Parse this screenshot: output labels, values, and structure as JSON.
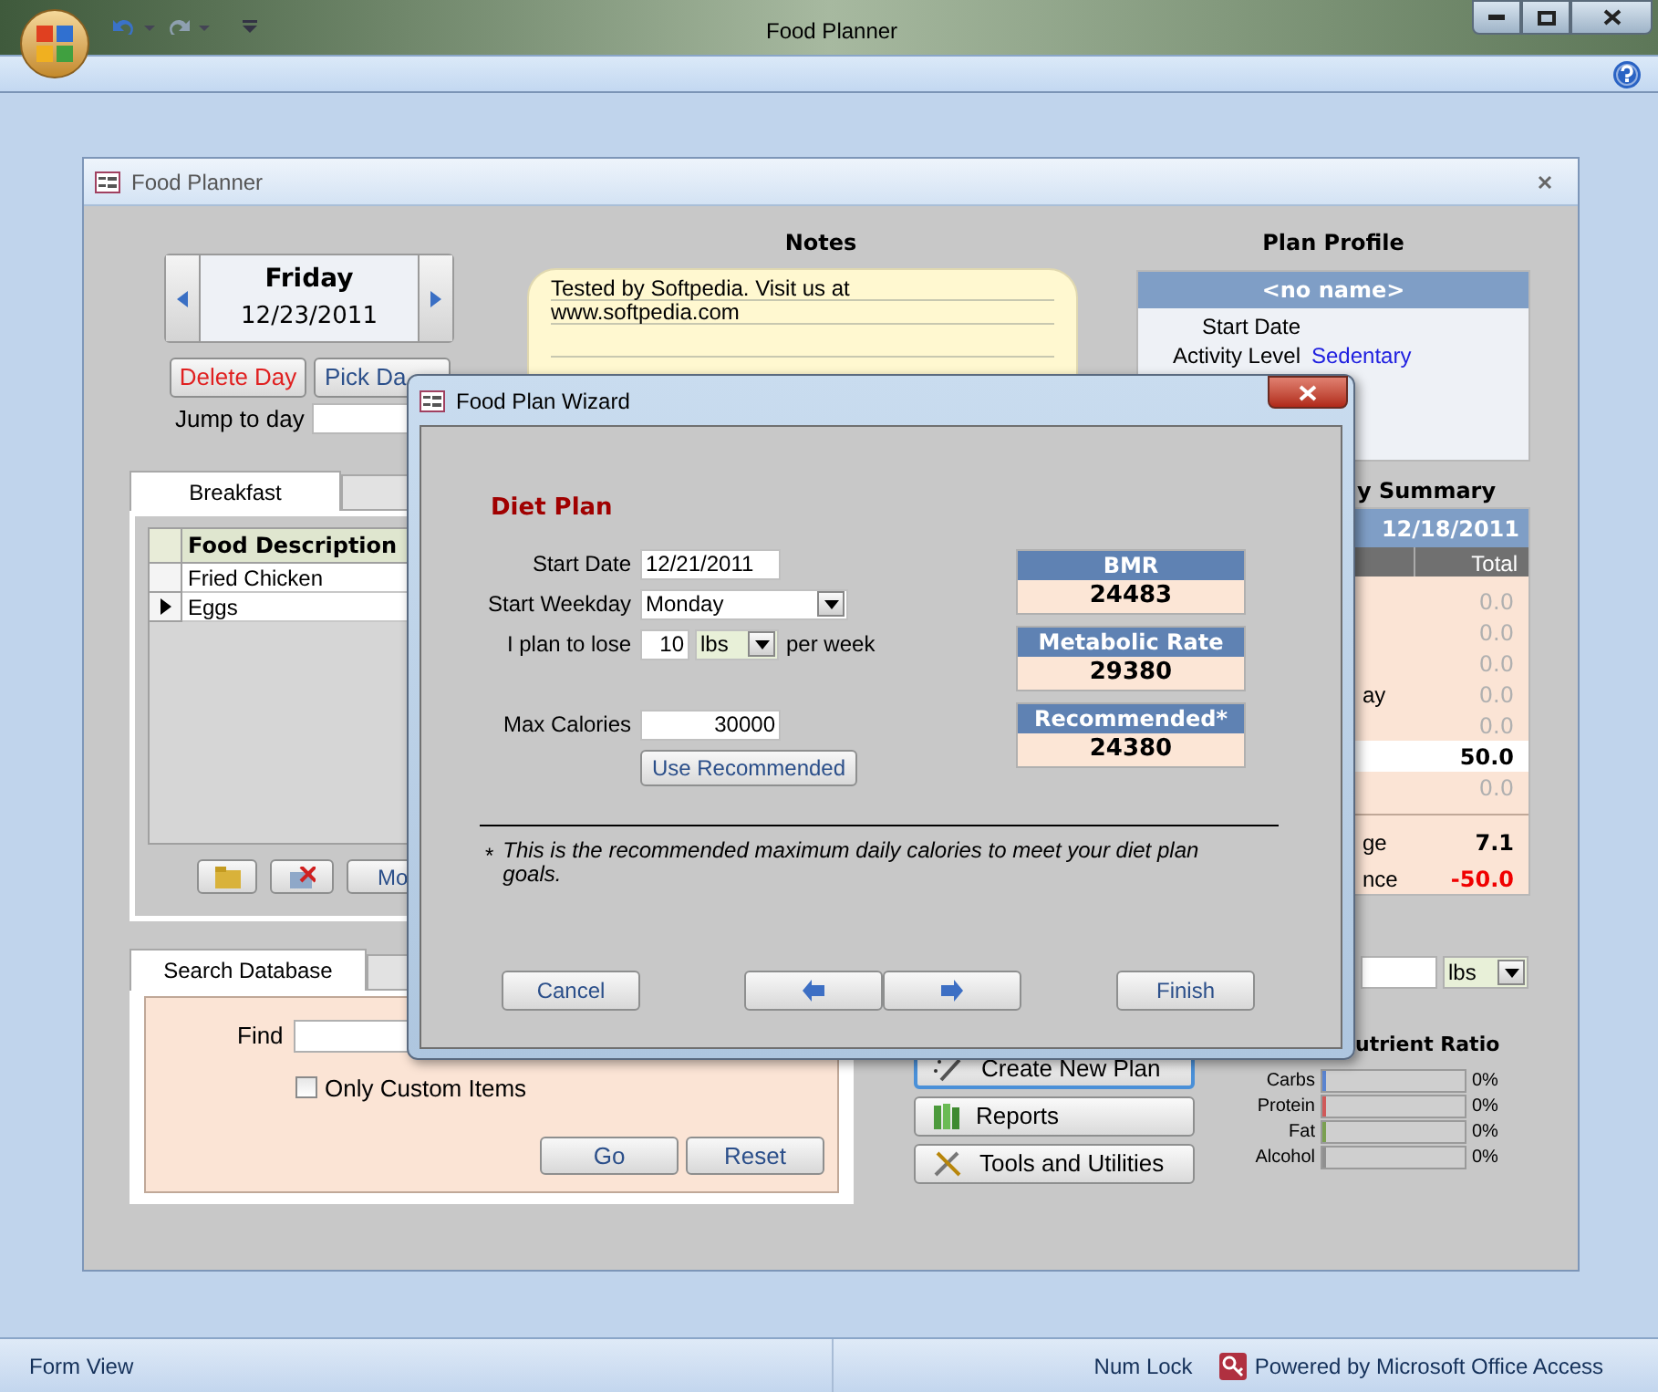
{
  "app": {
    "title": "Food Planner"
  },
  "form": {
    "title": "Food Planner",
    "day_nav": {
      "weekday": "Friday",
      "date": "12/23/2011"
    },
    "day_buttons": [
      {
        "label": "Delete Day",
        "kind": "danger"
      },
      {
        "label": "Pick Da",
        "kind": "normal"
      }
    ],
    "jump_to_day": {
      "label": "Jump to day"
    },
    "meal_tabs": [
      {
        "label": "Breakfast",
        "selected": true
      }
    ],
    "food_grid": {
      "columns": [
        "Food Description"
      ],
      "rows": [
        {
          "cells": [
            "Fried Chicken"
          ],
          "selected": false
        },
        {
          "cells": [
            "Eggs"
          ],
          "selected": true
        }
      ]
    },
    "meal_buttons": [
      {
        "kind": "add"
      },
      {
        "kind": "delete"
      },
      {
        "kind": "text",
        "label": "Mo"
      }
    ],
    "search": {
      "tab": "Search Database",
      "find_label": "Find",
      "only_custom": {
        "label": "Only Custom Items",
        "checked": false
      },
      "buttons": [
        "Go",
        "Reset"
      ]
    },
    "notes": {
      "title": "Notes",
      "lines": [
        "Tested by Softpedia. Visit us at",
        "www.softpedia.com"
      ]
    },
    "action_buttons": [
      {
        "label": "Create New Plan",
        "kind": "wand",
        "focused": true
      },
      {
        "label": "Reports",
        "kind": "reports",
        "focused": false
      },
      {
        "label": "Tools and Utilities",
        "kind": "tools",
        "focused": false
      }
    ],
    "plan_profile": {
      "title": "Plan Profile",
      "name": "<no name>",
      "fields": [
        {
          "label": "Start Date"
        },
        {
          "label": "Activity Level",
          "value": "Sedentary"
        }
      ]
    },
    "summary": {
      "title": "y Summary",
      "date": "12/18/2011",
      "total_header": "Total",
      "rows": [
        {
          "value": "0.0",
          "highlight": false
        },
        {
          "value": "0.0",
          "highlight": false
        },
        {
          "value": "0.0",
          "highlight": false
        },
        {
          "label": "ay",
          "value": "0.0",
          "highlight": false
        },
        {
          "value": "0.0",
          "highlight": false
        },
        {
          "value": "50.0",
          "highlight": true
        },
        {
          "value": "0.0",
          "highlight": false
        }
      ],
      "totals": [
        {
          "label": "ge",
          "value": "7.1",
          "negative": false
        },
        {
          "label": "nce",
          "value": "-50.0",
          "negative": true
        }
      ]
    },
    "weight_unit": {
      "value": "lbs"
    },
    "nutrient_ratio": {
      "title": "utrient Ratio",
      "items": [
        {
          "name": "Carbs",
          "level": 0,
          "color": "#5a84d0",
          "reading": "0%"
        },
        {
          "name": "Protein",
          "level": 0,
          "color": "#d05a5a",
          "reading": "0%"
        },
        {
          "name": "Fat",
          "level": 0,
          "color": "#7aa050",
          "reading": "0%"
        },
        {
          "name": "Alcohol",
          "level": 0,
          "color": "#909090",
          "reading": "0%"
        }
      ]
    }
  },
  "wizard": {
    "title": "Food Plan Wizard",
    "heading": "Diet Plan",
    "start_date": {
      "label": "Start Date",
      "value": "12/21/2011"
    },
    "start_weekday": {
      "label": "Start Weekday",
      "value": "Monday"
    },
    "lose": {
      "label": "I plan to lose",
      "amount": "10",
      "unit": "lbs",
      "suffix": "per week"
    },
    "max_calories": {
      "label": "Max Calories",
      "value": "30000"
    },
    "use_recommended": "Use Recommended",
    "stats": [
      {
        "label": "BMR",
        "value": "24483"
      },
      {
        "label": "Metabolic Rate",
        "value": "29380"
      },
      {
        "label": "Recommended*",
        "value": "24380"
      }
    ],
    "footnote": {
      "mark": "*",
      "text": "This is the recommended maximum daily calories to meet your diet plan goals."
    },
    "buttons": [
      {
        "kind": "text",
        "label": "Cancel"
      },
      {
        "kind": "back"
      },
      {
        "kind": "next"
      },
      {
        "kind": "text",
        "label": "Finish"
      }
    ]
  },
  "status_bar": {
    "view": "Form View",
    "num_lock": "Num Lock",
    "powered": "Powered by Microsoft Office Access"
  }
}
